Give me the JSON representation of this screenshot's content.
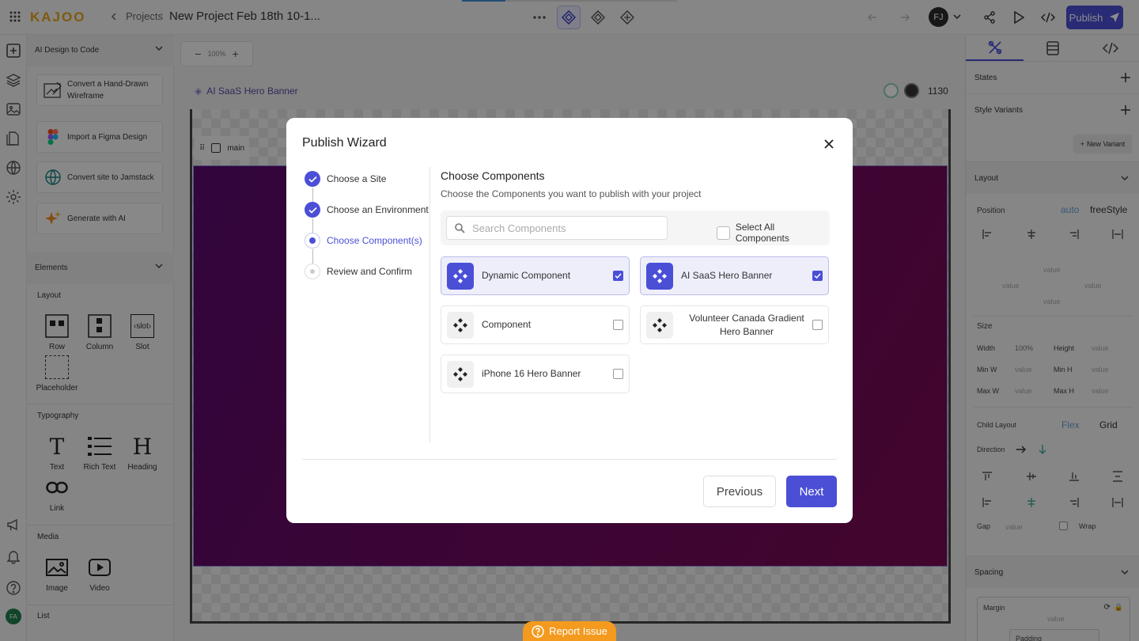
{
  "topbar": {
    "logo": "KAJOO",
    "back_label": "Projects",
    "project_title": "New Project Feb 18th 10-1...",
    "publish_label": "Publish",
    "user_initials": "FJ"
  },
  "left_panel": {
    "ai_section_title": "AI Design to Code",
    "ai_actions": [
      {
        "label": "Convert a Hand-Drawn Wireframe",
        "icon": "wireframe-icon"
      },
      {
        "label": "Import a Figma Design",
        "icon": "figma-icon"
      },
      {
        "label": "Convert site to Jamstack",
        "icon": "globe-icon"
      },
      {
        "label": "Generate with AI",
        "icon": "sparkle-icon"
      }
    ],
    "elements_title": "Elements",
    "layout_title": "Layout",
    "layout_items": [
      "Row",
      "Column",
      "Slot",
      "Placeholder"
    ],
    "slot_glyph": "‹slot›",
    "typography_title": "Typography",
    "typography_items": [
      "Text",
      "Rich Text",
      "Heading",
      "Link"
    ],
    "media_title": "Media",
    "media_items": [
      "Image",
      "Video"
    ],
    "list_title": "List",
    "user_badge": "FA"
  },
  "canvas": {
    "zoom": "100%",
    "component_name": "AI SaaS Hero Banner",
    "width_value": "1130",
    "main_label": "main"
  },
  "right_panel": {
    "states": "States",
    "style_variants": "Style Variants",
    "new_variant": "New Variant",
    "layout": "Layout",
    "position": "Position",
    "position_auto": "auto",
    "position_free": "freeStyle",
    "value_placeholder": "value",
    "size": "Size",
    "width": "Width",
    "width_value": "100%",
    "height": "Height",
    "min_w": "Min W",
    "min_h": "Min H",
    "max_w": "Max W",
    "max_h": "Max H",
    "child_layout": "Child Layout",
    "flex": "Flex",
    "grid": "Grid",
    "direction": "Direction",
    "gap": "Gap",
    "wrap": "Wrap",
    "spacing": "Spacing",
    "margin": "Margin",
    "padding": "Padding"
  },
  "modal": {
    "title": "Publish Wizard",
    "steps": [
      {
        "label": "Choose a Site",
        "state": "done"
      },
      {
        "label": "Choose an Environment",
        "state": "done"
      },
      {
        "label": "Choose Component(s)",
        "state": "current"
      },
      {
        "label": "Review and Confirm",
        "state": "todo"
      }
    ],
    "heading": "Choose Components",
    "subheading": "Choose the Components you want to publish with your project",
    "search_placeholder": "Search Components",
    "select_all": "Select All Components",
    "components": [
      {
        "name": "Dynamic Component",
        "checked": true
      },
      {
        "name": "AI SaaS Hero Banner",
        "checked": true
      },
      {
        "name": "Component",
        "checked": false
      },
      {
        "name": "Volunteer Canada Gradient Hero Banner",
        "checked": false
      },
      {
        "name": "iPhone 16 Hero Banner",
        "checked": false
      }
    ],
    "previous_label": "Previous",
    "next_label": "Next"
  },
  "report_issue": "Report Issue",
  "colors": {
    "accent": "#4b4fd6",
    "canvas_purple": "#6e0a5f",
    "report": "#f39a1f"
  }
}
